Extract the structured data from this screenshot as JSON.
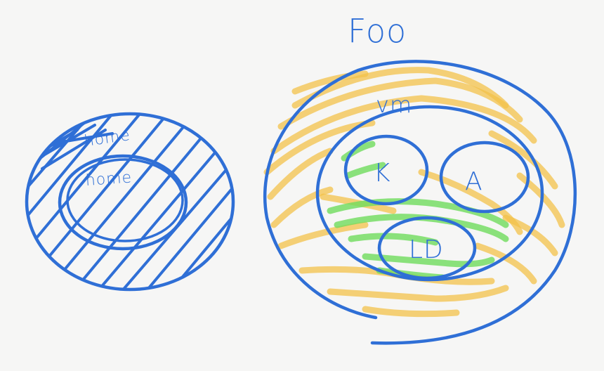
{
  "diagram": {
    "left_cluster": {
      "outer_label": "home",
      "inner_label": "home"
    },
    "right_cluster": {
      "title": "Foo",
      "middle_label": "vm",
      "circles": [
        {
          "id": "k",
          "label": "K"
        },
        {
          "id": "a",
          "label": "A"
        },
        {
          "id": "ld",
          "label": "LD"
        }
      ]
    }
  },
  "colors": {
    "ink": "#2f6fd6",
    "highlight_yellow": "#f3c24a",
    "highlight_green": "#6fdc5c",
    "paper": "#f6f6f5"
  }
}
